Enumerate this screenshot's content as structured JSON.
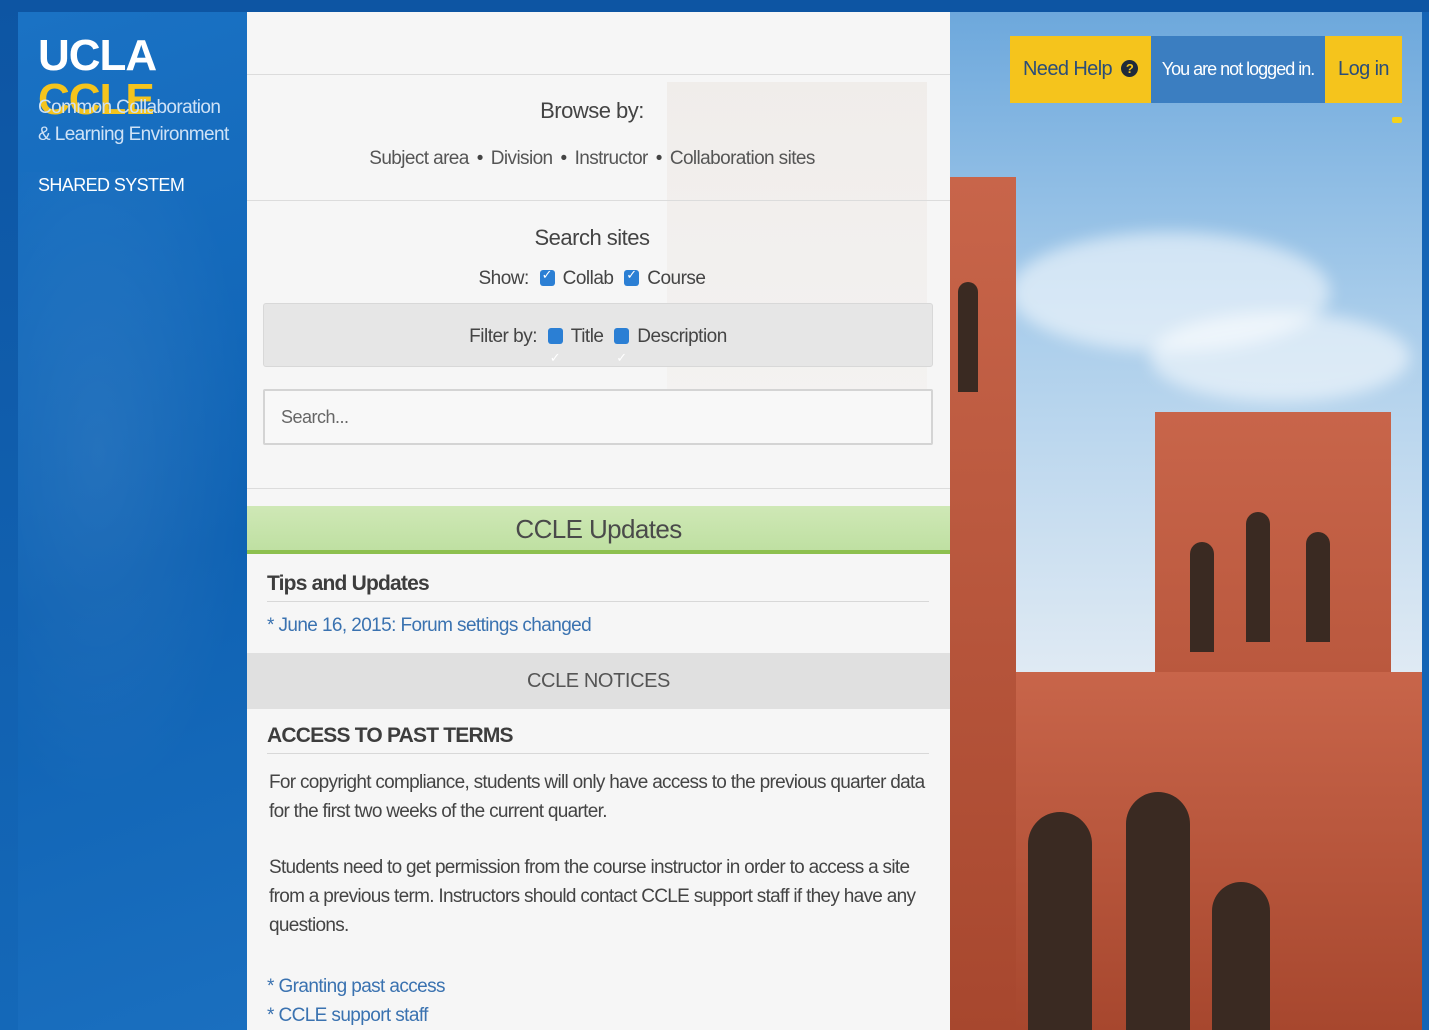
{
  "brand": {
    "logo_part1": "UCLA",
    "logo_part2": "CCLE",
    "tagline_line1": "Common Collaboration",
    "tagline_line2": "& Learning Environment",
    "system_label": "SHARED SYSTEM"
  },
  "header": {
    "help_label": "Need Help",
    "help_icon": "?",
    "login_status": "You are not logged in.",
    "login_label": "Log in"
  },
  "browse": {
    "title": "Browse by:",
    "links": [
      "Subject area",
      "Division",
      "Instructor",
      "Collaboration sites"
    ]
  },
  "search": {
    "title": "Search sites",
    "show_label": "Show:",
    "show_options": [
      "Collab",
      "Course"
    ],
    "filter_label": "Filter by:",
    "filter_options": [
      "Title",
      "Description"
    ],
    "placeholder": "Search..."
  },
  "updates": {
    "bar_title": "CCLE Updates",
    "tips_heading": "Tips and Updates",
    "tips_link": "* June 16, 2015: Forum settings changed"
  },
  "notices": {
    "bar_title": "CCLE NOTICES",
    "heading": "ACCESS TO PAST TERMS",
    "paragraph1": "For copyright compliance, students will only have access to the previous quarter data for the first two weeks of the current quarter.",
    "paragraph2": "Students need to get permission from the course instructor in order to access a site from a previous term. Instructors should contact CCLE support staff if they have any questions.",
    "links": [
      "* Granting past access",
      "* CCLE support staff"
    ]
  },
  "colors": {
    "brand_blue": "#0f62b3",
    "brand_gold": "#f5c41c",
    "updates_green": "#8dc04f",
    "link_blue": "#3a72b0"
  }
}
